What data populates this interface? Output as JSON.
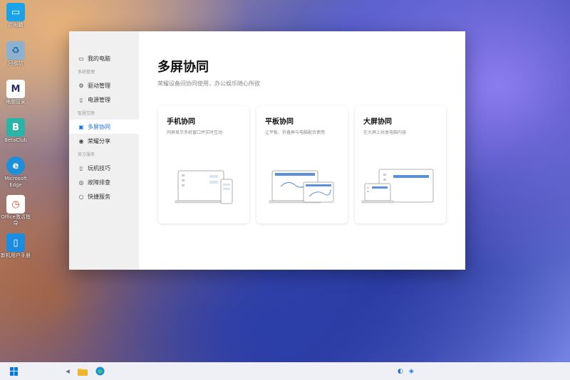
{
  "desktop": {
    "icons": [
      {
        "label": "此电脑",
        "glyph": "▭",
        "color": "#1aa3e8"
      },
      {
        "label": "回收站",
        "glyph": "♻",
        "color": "#7fa6c7"
      },
      {
        "label": "电脑管家",
        "glyph": "M",
        "color": "#ffffff"
      },
      {
        "label": "BetaClub",
        "glyph": "B",
        "color": "#2bb3a8"
      },
      {
        "label": "Microsoft Edge",
        "glyph": "e",
        "color": "#1f8fd8"
      },
      {
        "label": "Office激活指导",
        "glyph": "◷",
        "color": "#e2461f"
      },
      {
        "label": "新机用户手册",
        "glyph": "▯",
        "color": "#1b8de0"
      }
    ]
  },
  "sidebar": {
    "items": [
      {
        "icon": "▭",
        "label": "我的电脑"
      },
      {
        "section": "系统管理"
      },
      {
        "icon": "⚙",
        "label": "驱动管理"
      },
      {
        "icon": "▯",
        "label": "电源管理"
      },
      {
        "section": "智慧互联"
      },
      {
        "icon": "▣",
        "label": "多屏协同",
        "active": true
      },
      {
        "icon": "◉",
        "label": "荣耀分享"
      },
      {
        "section": "官方服务"
      },
      {
        "icon": "▯",
        "label": "玩机技巧"
      },
      {
        "icon": "◎",
        "label": "故障排查"
      },
      {
        "icon": "○",
        "label": "快捷服务"
      }
    ]
  },
  "main": {
    "title": "多屏协同",
    "subtitle": "荣耀设备间协同使用，办公娱乐随心所欲",
    "cards": [
      {
        "title": "手机协同",
        "desc": "同屏显示手机窗口并实时互动"
      },
      {
        "title": "平板协同",
        "desc": "让平板、折叠屏与电脑配合使用"
      },
      {
        "title": "大屏协同",
        "desc": "在大屏上共享电脑内容"
      }
    ]
  },
  "accent": "#1e6fd9"
}
